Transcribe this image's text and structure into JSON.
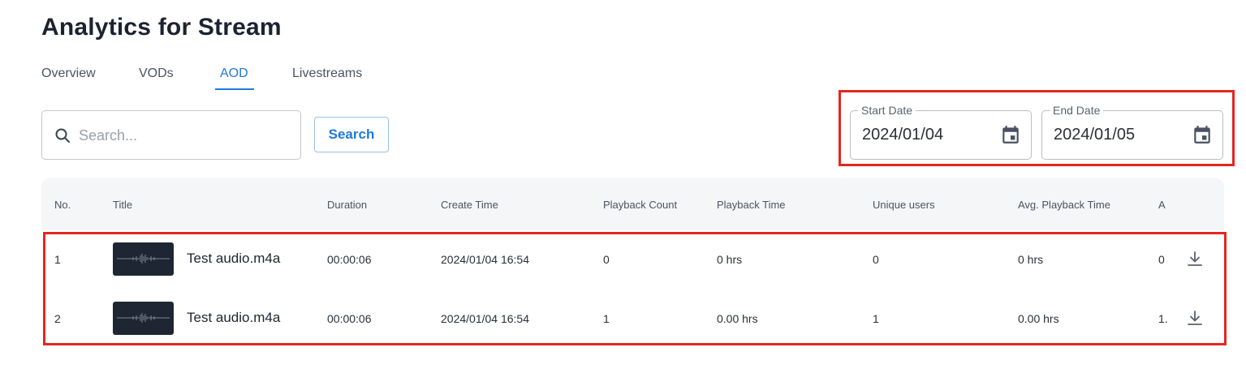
{
  "page": {
    "title": "Analytics for Stream"
  },
  "tabs": [
    {
      "label": "Overview"
    },
    {
      "label": "VODs"
    },
    {
      "label": "AOD",
      "active": true
    },
    {
      "label": "Livestreams"
    }
  ],
  "search": {
    "placeholder": "Search...",
    "value": "",
    "button_label": "Search",
    "icon": "search-icon"
  },
  "date_range": {
    "start": {
      "label": "Start Date",
      "value": "2024/01/04",
      "icon": "calendar-icon"
    },
    "end": {
      "label": "End Date",
      "value": "2024/01/05",
      "icon": "calendar-icon"
    }
  },
  "table": {
    "columns": [
      "No.",
      "Title",
      "Duration",
      "Create Time",
      "Playback Count",
      "Playback Time",
      "Unique users",
      "Avg. Playback Time",
      "A"
    ],
    "rows": [
      {
        "no": "1",
        "title": "Test audio.m4a",
        "duration": "00:00:06",
        "create_time": "2024/01/04 16:54",
        "playback_count": "0",
        "playback_time": "0 hrs",
        "unique_users": "0",
        "avg_playback_time": "0 hrs",
        "a": "0"
      },
      {
        "no": "2",
        "title": "Test audio.m4a",
        "duration": "00:00:06",
        "create_time": "2024/01/04 16:54",
        "playback_count": "1",
        "playback_time": "0.00 hrs",
        "unique_users": "1",
        "avg_playback_time": "0.00 hrs",
        "a": "1."
      }
    ],
    "row_action_icon": "download-icon",
    "thumbnail_icon": "audio-waveform-icon"
  },
  "colors": {
    "accent": "#1f7ae0",
    "highlight": "#e6251f",
    "header_bg": "#f5f6f8",
    "thumbnail_bg": "#1e2633"
  }
}
